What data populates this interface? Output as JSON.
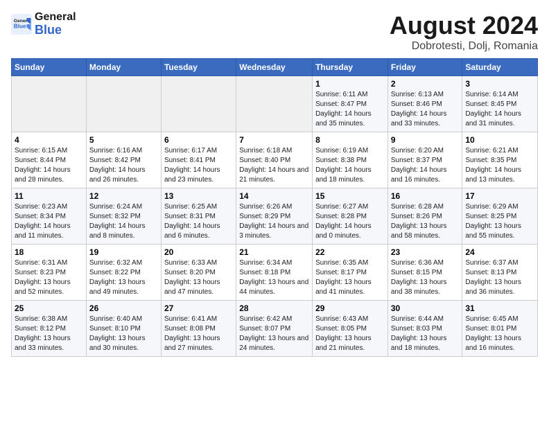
{
  "header": {
    "logo_general": "General",
    "logo_blue": "Blue",
    "month_year": "August 2024",
    "location": "Dobrotesti, Dolj, Romania"
  },
  "days_header": [
    "Sunday",
    "Monday",
    "Tuesday",
    "Wednesday",
    "Thursday",
    "Friday",
    "Saturday"
  ],
  "weeks": [
    [
      {
        "day": "",
        "info": ""
      },
      {
        "day": "",
        "info": ""
      },
      {
        "day": "",
        "info": ""
      },
      {
        "day": "",
        "info": ""
      },
      {
        "day": "1",
        "info": "Sunrise: 6:11 AM\nSunset: 8:47 PM\nDaylight: 14 hours\nand 35 minutes."
      },
      {
        "day": "2",
        "info": "Sunrise: 6:13 AM\nSunset: 8:46 PM\nDaylight: 14 hours\nand 33 minutes."
      },
      {
        "day": "3",
        "info": "Sunrise: 6:14 AM\nSunset: 8:45 PM\nDaylight: 14 hours\nand 31 minutes."
      }
    ],
    [
      {
        "day": "4",
        "info": "Sunrise: 6:15 AM\nSunset: 8:44 PM\nDaylight: 14 hours\nand 28 minutes."
      },
      {
        "day": "5",
        "info": "Sunrise: 6:16 AM\nSunset: 8:42 PM\nDaylight: 14 hours\nand 26 minutes."
      },
      {
        "day": "6",
        "info": "Sunrise: 6:17 AM\nSunset: 8:41 PM\nDaylight: 14 hours\nand 23 minutes."
      },
      {
        "day": "7",
        "info": "Sunrise: 6:18 AM\nSunset: 8:40 PM\nDaylight: 14 hours\nand 21 minutes."
      },
      {
        "day": "8",
        "info": "Sunrise: 6:19 AM\nSunset: 8:38 PM\nDaylight: 14 hours\nand 18 minutes."
      },
      {
        "day": "9",
        "info": "Sunrise: 6:20 AM\nSunset: 8:37 PM\nDaylight: 14 hours\nand 16 minutes."
      },
      {
        "day": "10",
        "info": "Sunrise: 6:21 AM\nSunset: 8:35 PM\nDaylight: 14 hours\nand 13 minutes."
      }
    ],
    [
      {
        "day": "11",
        "info": "Sunrise: 6:23 AM\nSunset: 8:34 PM\nDaylight: 14 hours\nand 11 minutes."
      },
      {
        "day": "12",
        "info": "Sunrise: 6:24 AM\nSunset: 8:32 PM\nDaylight: 14 hours\nand 8 minutes."
      },
      {
        "day": "13",
        "info": "Sunrise: 6:25 AM\nSunset: 8:31 PM\nDaylight: 14 hours\nand 6 minutes."
      },
      {
        "day": "14",
        "info": "Sunrise: 6:26 AM\nSunset: 8:29 PM\nDaylight: 14 hours\nand 3 minutes."
      },
      {
        "day": "15",
        "info": "Sunrise: 6:27 AM\nSunset: 8:28 PM\nDaylight: 14 hours\nand 0 minutes."
      },
      {
        "day": "16",
        "info": "Sunrise: 6:28 AM\nSunset: 8:26 PM\nDaylight: 13 hours\nand 58 minutes."
      },
      {
        "day": "17",
        "info": "Sunrise: 6:29 AM\nSunset: 8:25 PM\nDaylight: 13 hours\nand 55 minutes."
      }
    ],
    [
      {
        "day": "18",
        "info": "Sunrise: 6:31 AM\nSunset: 8:23 PM\nDaylight: 13 hours\nand 52 minutes."
      },
      {
        "day": "19",
        "info": "Sunrise: 6:32 AM\nSunset: 8:22 PM\nDaylight: 13 hours\nand 49 minutes."
      },
      {
        "day": "20",
        "info": "Sunrise: 6:33 AM\nSunset: 8:20 PM\nDaylight: 13 hours\nand 47 minutes."
      },
      {
        "day": "21",
        "info": "Sunrise: 6:34 AM\nSunset: 8:18 PM\nDaylight: 13 hours\nand 44 minutes."
      },
      {
        "day": "22",
        "info": "Sunrise: 6:35 AM\nSunset: 8:17 PM\nDaylight: 13 hours\nand 41 minutes."
      },
      {
        "day": "23",
        "info": "Sunrise: 6:36 AM\nSunset: 8:15 PM\nDaylight: 13 hours\nand 38 minutes."
      },
      {
        "day": "24",
        "info": "Sunrise: 6:37 AM\nSunset: 8:13 PM\nDaylight: 13 hours\nand 36 minutes."
      }
    ],
    [
      {
        "day": "25",
        "info": "Sunrise: 6:38 AM\nSunset: 8:12 PM\nDaylight: 13 hours\nand 33 minutes."
      },
      {
        "day": "26",
        "info": "Sunrise: 6:40 AM\nSunset: 8:10 PM\nDaylight: 13 hours\nand 30 minutes."
      },
      {
        "day": "27",
        "info": "Sunrise: 6:41 AM\nSunset: 8:08 PM\nDaylight: 13 hours\nand 27 minutes."
      },
      {
        "day": "28",
        "info": "Sunrise: 6:42 AM\nSunset: 8:07 PM\nDaylight: 13 hours\nand 24 minutes."
      },
      {
        "day": "29",
        "info": "Sunrise: 6:43 AM\nSunset: 8:05 PM\nDaylight: 13 hours\nand 21 minutes."
      },
      {
        "day": "30",
        "info": "Sunrise: 6:44 AM\nSunset: 8:03 PM\nDaylight: 13 hours\nand 18 minutes."
      },
      {
        "day": "31",
        "info": "Sunrise: 6:45 AM\nSunset: 8:01 PM\nDaylight: 13 hours\nand 16 minutes."
      }
    ]
  ]
}
